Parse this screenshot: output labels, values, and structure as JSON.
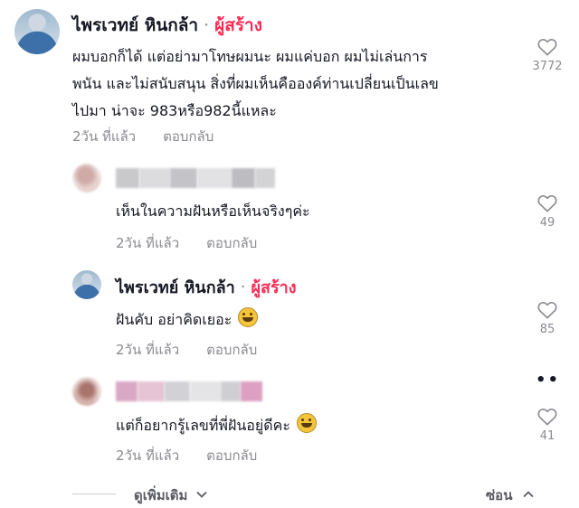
{
  "comments": [
    {
      "username": "ไพรเวทย์ หินกล้า",
      "creator_separator": "·",
      "creator_badge": "ผู้สร้าง",
      "text_lines": [
        "ผมบอกก็ได้ แต่อย่ามาโทษผมนะ ผมแค่บอก ผมไม่เล่นการ",
        "พนัน และไม่สนับสนุน สิ่งที่ผมเห็นคือองค์ท่านเปลี่ยนเป็นเลข",
        "ไปมา น่าจะ 983หรือ982นี้แหละ"
      ],
      "time": "2วัน ที่แล้ว",
      "reply_label": "ตอบกลับ",
      "likes": "3772"
    },
    {
      "text": "เห็นในความฝันหรือเห็นจริงๆค่ะ",
      "time": "2วัน ที่แล้ว",
      "reply_label": "ตอบกลับ",
      "likes": "49"
    },
    {
      "username": "ไพรเวทย์ หินกล้า",
      "creator_separator": "·",
      "creator_badge": "ผู้สร้าง",
      "text": "ฝันคับ อย่าคิดเยอะ",
      "time": "2วัน ที่แล้ว",
      "reply_label": "ตอบกลับ",
      "likes": "85"
    },
    {
      "text": "แต่ก็อยากรู้เลขที่พี่ฝันอยู่ดีคะ",
      "time": "2วัน ที่แล้ว",
      "reply_label": "ตอบกลับ",
      "likes": "41"
    }
  ],
  "more_dots": "••",
  "footer": {
    "see_more": "ดูเพิ่มเติม",
    "hide": "ซ่อน"
  },
  "colors": {
    "creator_badge": "#fe2c55",
    "secondary_text": "#8a8b91",
    "heart_outline": "#8a8b91"
  },
  "icons": [
    "heart-outline-icon",
    "chevron-down-icon",
    "chevron-up-icon",
    "grinning-emoji-icon",
    "laughing-emoji-icon"
  ]
}
